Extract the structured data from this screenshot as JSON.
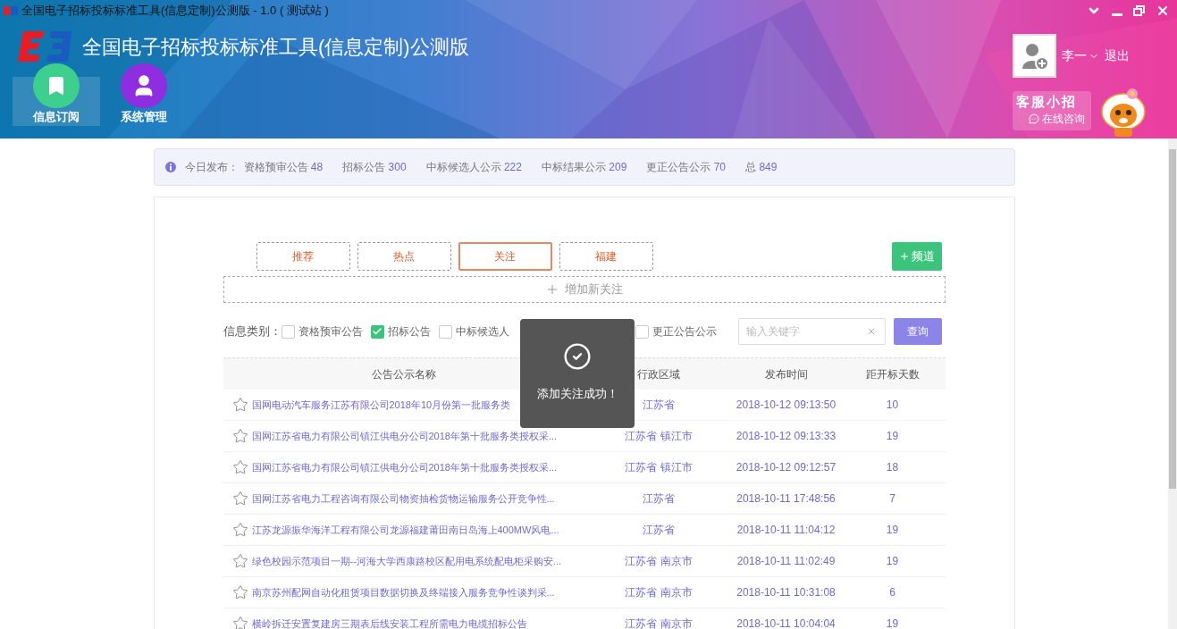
{
  "window": {
    "title": "全国电子招标投标标准工具(信息定制)公测版 - 1.0 ( 测试站 )"
  },
  "header": {
    "app_name": "全国电子招标投标标准工具(信息定制)公测版",
    "nav": [
      {
        "label": "信息订阅",
        "selected": true,
        "kind": "bookmark",
        "color": "#3ccf8e"
      },
      {
        "label": "系统管理",
        "selected": false,
        "kind": "user",
        "color": "#8f2ee0"
      }
    ],
    "user": {
      "name": "李一",
      "logout": "退出"
    },
    "service": {
      "title": "客服小招",
      "link": "在线咨询"
    }
  },
  "notice": {
    "label": "今日发布：",
    "stats": [
      {
        "label": "资格预审公告",
        "count": "48"
      },
      {
        "label": "招标公告",
        "count": "300"
      },
      {
        "label": "中标候选人公示",
        "count": "222"
      },
      {
        "label": "中标结果公示",
        "count": "209"
      },
      {
        "label": "更正公告公示",
        "count": "70"
      },
      {
        "label": "总",
        "count": "849"
      }
    ]
  },
  "tabs": [
    {
      "label": "推荐",
      "selected": false
    },
    {
      "label": "热点",
      "selected": false
    },
    {
      "label": "关注",
      "selected": true
    },
    {
      "label": "福建",
      "selected": false
    }
  ],
  "add_channel": "频道",
  "add_follow": "增加新关注",
  "filter": {
    "label": "信息类别：",
    "options": [
      {
        "label": "资格预审公告",
        "checked": false
      },
      {
        "label": "招标公告",
        "checked": true
      },
      {
        "label": "中标候选人",
        "checked": false
      },
      {
        "label": "更正公告公示",
        "checked": false
      }
    ]
  },
  "search": {
    "placeholder": "输入关键字"
  },
  "query_button": "查询",
  "table": {
    "columns": [
      "公告公示名称",
      "行政区域",
      "发布时间",
      "距开标天数"
    ],
    "rows": [
      {
        "starred": false,
        "name": "国网电动汽车服务江苏有限公司2018年10月份第一批服务类",
        "region": "江苏省",
        "time": "2018-10-12 09:13:50",
        "days": "10"
      },
      {
        "starred": false,
        "name": "国网江苏省电力有限公司镇江供电分公司2018年第十批服务类授权采...",
        "region": "江苏省 镇江市",
        "time": "2018-10-12 09:13:33",
        "days": "19"
      },
      {
        "starred": false,
        "name": "国网江苏省电力有限公司镇江供电分公司2018年第十批服务类授权采...",
        "region": "江苏省 镇江市",
        "time": "2018-10-12 09:12:57",
        "days": "18"
      },
      {
        "starred": false,
        "name": "国网江苏省电力工程咨询有限公司物资抽检货物运输服务公开竞争性...",
        "region": "江苏省",
        "time": "2018-10-11 17:48:56",
        "days": "7"
      },
      {
        "starred": false,
        "name": "江苏龙源振华海洋工程有限公司龙源福建莆田南日岛海上400MW风电...",
        "region": "江苏省",
        "time": "2018-10-11 11:04:12",
        "days": "19"
      },
      {
        "starred": false,
        "name": "绿色校园示范项目一期--河海大学西康路校区配用电系统配电柜采购安...",
        "region": "江苏省 南京市",
        "time": "2018-10-11 11:02:49",
        "days": "19"
      },
      {
        "starred": false,
        "name": "南京苏州配网自动化租赁项目数据切换及终端接入服务竞争性谈判采...",
        "region": "江苏省 南京市",
        "time": "2018-10-11 10:31:08",
        "days": "6"
      },
      {
        "starred": false,
        "name": "横岭拆迁安置复建房三期表后线安装工程所需电力电缆招标公告",
        "region": "江苏省 南京市",
        "time": "2018-10-11 10:04:04",
        "days": "19"
      }
    ]
  },
  "toast": {
    "message": "添加关注成功！"
  }
}
